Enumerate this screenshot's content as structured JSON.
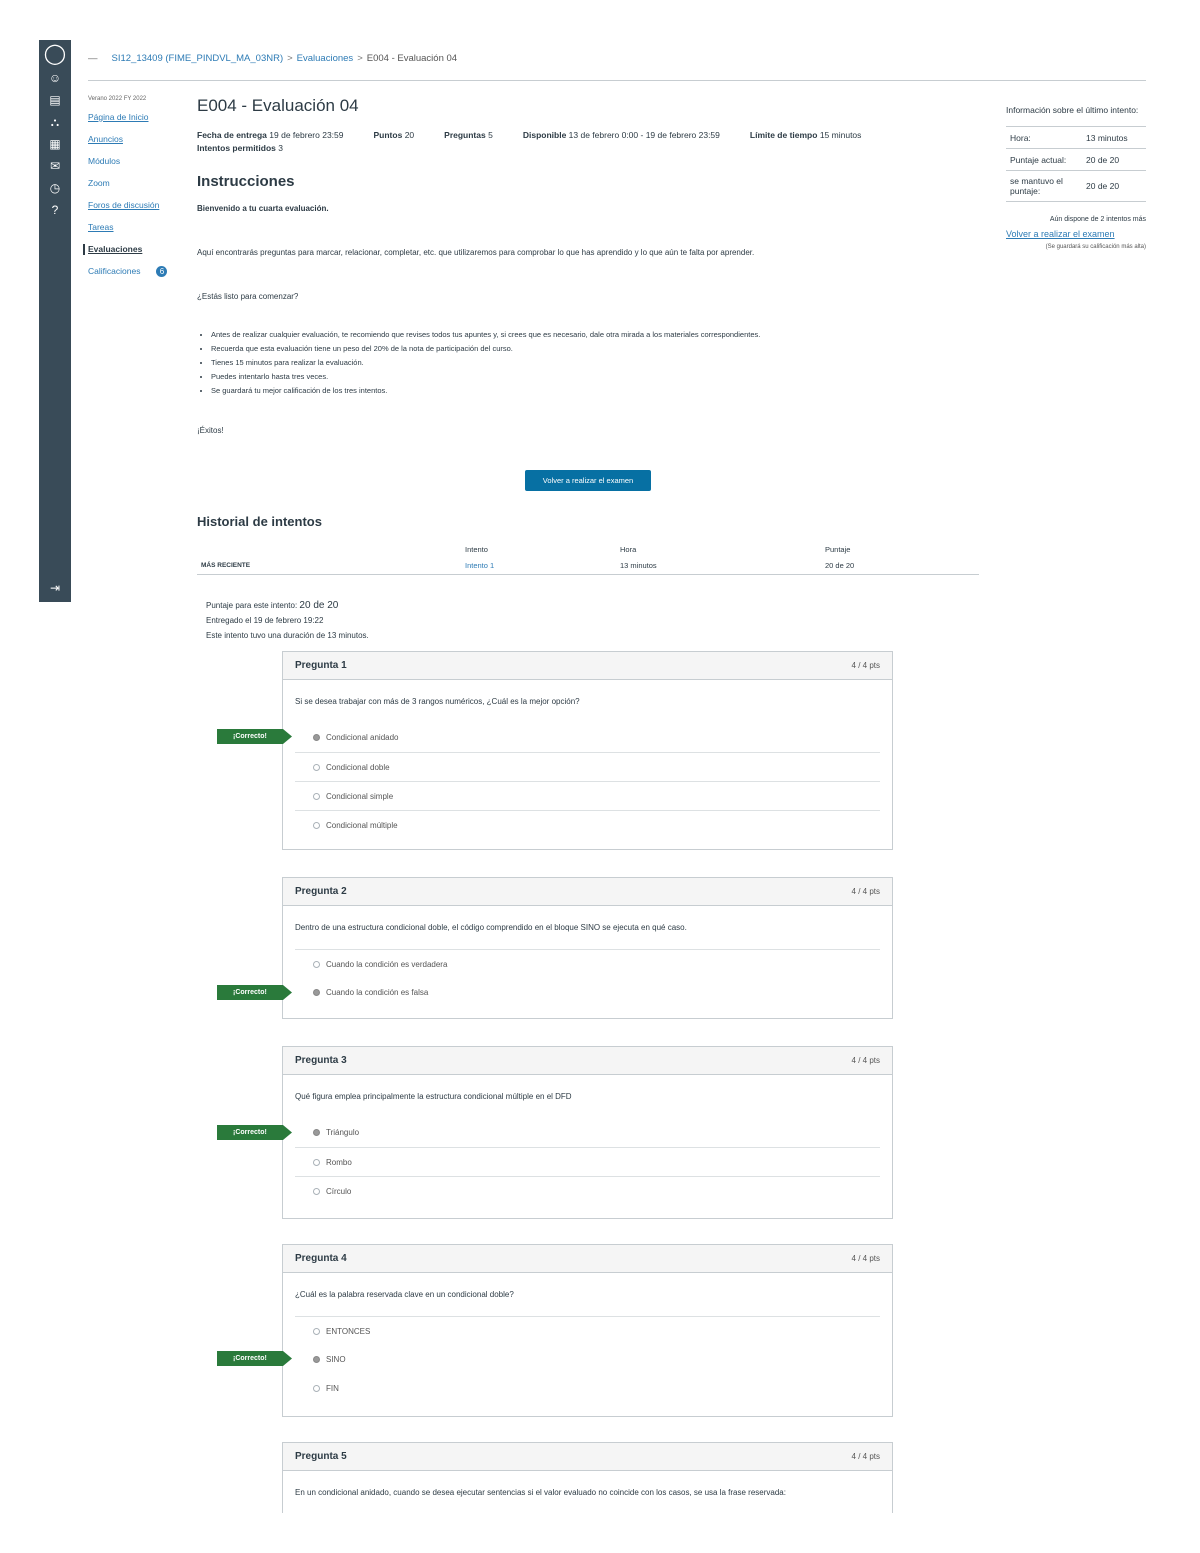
{
  "breadcrumb": {
    "course": "SI12_13409 (FIME_PINDVL_MA_03NR)",
    "section": "Evaluaciones",
    "current": "E004 - Evaluación 04",
    "separator": ">"
  },
  "course_nav": {
    "term": "Verano 2022 FY 2022",
    "items": [
      {
        "label": "Página de Inicio"
      },
      {
        "label": "Anuncios"
      },
      {
        "label": "Módulos"
      },
      {
        "label": "Zoom"
      },
      {
        "label": "Foros de discusión"
      },
      {
        "label": "Tareas"
      },
      {
        "label": "Evaluaciones"
      },
      {
        "label": "Calificaciones",
        "badge": "6"
      }
    ]
  },
  "quiz": {
    "title": "E004 - Evaluación 04",
    "due_label": "Fecha de entrega",
    "due_value": "19 de febrero 23:59",
    "points_label": "Puntos",
    "points_value": "20",
    "questions_label": "Preguntas",
    "questions_value": "5",
    "available_label": "Disponible",
    "available_value": "13 de febrero 0:00 - 19 de febrero 23:59",
    "time_limit_label": "Límite de tiempo",
    "time_limit_value": "15 minutos",
    "attempts_label": "Intentos permitidos",
    "attempts_value": "3"
  },
  "instructions": {
    "heading": "Instrucciones",
    "welcome": "Bienvenido a tu cuarta evaluación.",
    "intro": "Aquí encontrarás preguntas para marcar, relacionar, completar, etc. que utilizaremos para comprobar lo que has aprendido y lo que aún te falta por aprender.",
    "ready": "¿Estás listo para comenzar?",
    "bullets": [
      "Antes de realizar cualquier evaluación, te recomiendo que revises todos tus apuntes y, si crees que es necesario, dale otra mirada a los materiales correspondientes.",
      "Recuerda que esta evaluación tiene un peso del 20% de la nota de participación del curso.",
      "Tienes 15 minutos para realizar la evaluación.",
      "Puedes intentarlo hasta tres veces.",
      "Se guardará tu mejor calificación de los tres intentos."
    ],
    "success": "¡Éxitos!",
    "retake_button": "Volver a realizar el examen"
  },
  "history": {
    "heading": "Historial de intentos",
    "columns": [
      "",
      "Intento",
      "Hora",
      "Puntaje"
    ],
    "rows": [
      {
        "label": "MÁS RECIENTE",
        "attempt": "Intento 1",
        "time": "13 minutos",
        "score": "20 de 20"
      }
    ]
  },
  "summary": {
    "score_label": "Puntaje para este intento:",
    "score_value": "20 de 20",
    "submitted": "Entregado el 19 de febrero 19:22",
    "duration": "Este intento tuvo una duración de 13 minutos."
  },
  "correct_label": "¡Correcto!",
  "questions": [
    {
      "title": "Pregunta 1",
      "points": "4 / 4 pts",
      "text": "Si se desea trabajar con más de 3 rangos numéricos, ¿Cuál es la mejor opción?",
      "answers": [
        "Condicional anidado",
        "Condicional doble",
        "Condicional simple",
        "Condicional múltiple"
      ],
      "selected": 0
    },
    {
      "title": "Pregunta 2",
      "points": "4 / 4 pts",
      "text": "Dentro de una estructura condicional doble, el código comprendido en el bloque SINO se ejecuta en qué caso.",
      "answers": [
        "Cuando la condición es verdadera",
        "Cuando la condición es falsa"
      ],
      "selected": 1
    },
    {
      "title": "Pregunta 3",
      "points": "4 / 4 pts",
      "text": "Qué figura emplea principalmente la estructura condicional múltiple en el DFD",
      "answers": [
        "Triángulo",
        "Rombo",
        "Círculo"
      ],
      "selected": 0
    },
    {
      "title": "Pregunta 4",
      "points": "4 / 4 pts",
      "text": "¿Cuál es la palabra reservada clave en un condicional doble?",
      "answers": [
        "ENTONCES",
        "SINO",
        "FIN"
      ],
      "selected": 1
    },
    {
      "title": "Pregunta 5",
      "points": "4 / 4 pts",
      "text": "En un condicional anidado, cuando se desea ejecutar sentencias si el valor evaluado no coincide con los casos, se usa la frase reservada:",
      "answers": [],
      "selected": -1
    }
  ],
  "sidebar": {
    "heading": "Información sobre el último intento:",
    "rows": [
      {
        "label": "Hora:",
        "value": "13 minutos"
      },
      {
        "label": "Puntaje actual:",
        "value": "20 de 20"
      },
      {
        "label": "se mantuvo el puntaje:",
        "value": "20 de 20"
      }
    ],
    "remaining": "Aún dispone de 2 intentos más",
    "retake_link": "Volver a realizar el examen",
    "note": "(Se guardará su calificación más alta)"
  },
  "icons": {
    "global_nav": [
      "logo-icon",
      "account-icon",
      "dashboard-icon",
      "courses-icon",
      "calendar-icon",
      "inbox-icon",
      "history-icon",
      "help-icon",
      "collapse-icon"
    ]
  }
}
